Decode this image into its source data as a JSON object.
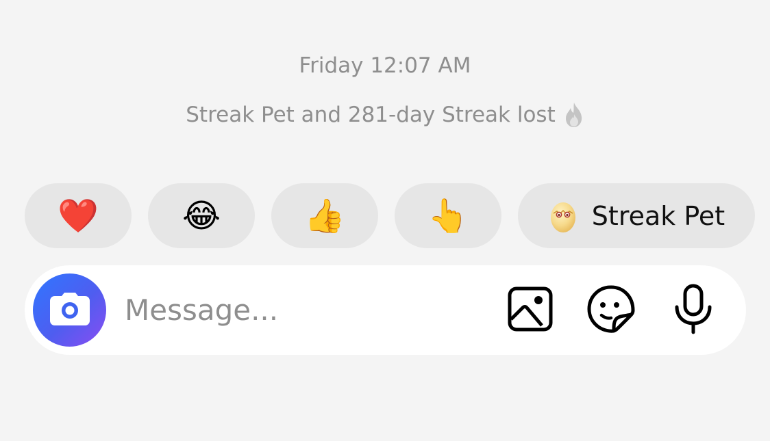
{
  "conversation": {
    "timestamp": "Friday 12:07 AM",
    "system_note": "Streak Pet and 281-day Streak lost",
    "system_note_icon": "fire-icon"
  },
  "quick_reactions": [
    {
      "emoji": "❤️",
      "icon": "red-heart-icon"
    },
    {
      "emoji": "😂",
      "icon": "tears-of-joy-icon"
    },
    {
      "emoji": "👍",
      "icon": "thumbs-up-icon"
    },
    {
      "emoji": "👆",
      "icon": "pointing-up-icon"
    },
    {
      "label": "Streak Pet",
      "icon": "streak-pet-egg-icon"
    }
  ],
  "composer": {
    "placeholder": "Message...",
    "value": "",
    "camera_icon": "camera-icon",
    "tools": [
      "photo-icon",
      "sticker-icon",
      "microphone-icon"
    ]
  },
  "colors": {
    "background": "#f4f4f4",
    "chip": "#e6e6e6",
    "muted_text": "#8e8e8e",
    "camera_gradient_start": "#2f77ff",
    "camera_gradient_end": "#8a4df2"
  }
}
